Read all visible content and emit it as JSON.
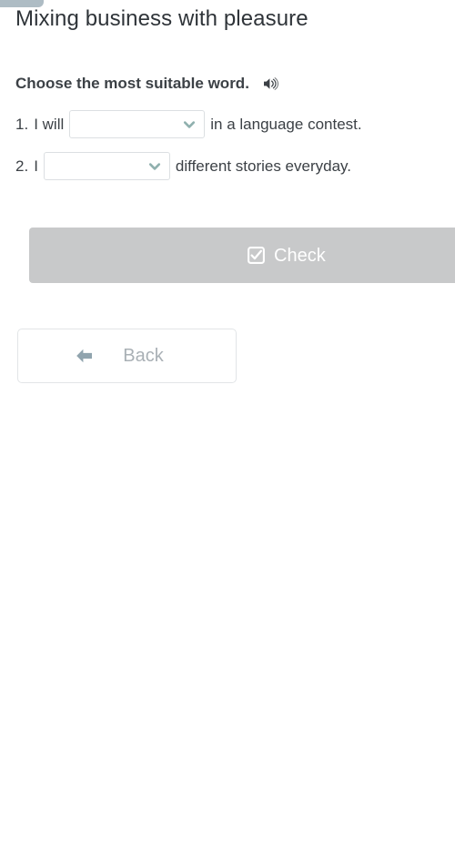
{
  "theme": {
    "page_background": "#ffffff",
    "text_color": "#3c4146",
    "title_color": "#2f3439",
    "accent_chevron": "#8fb0ae",
    "badge_color": "#aebcc4",
    "disabled_button_bg": "#c8c9ca",
    "back_arrow_color": "#90a4ae",
    "back_label_color": "#a9b0b5",
    "input_border": "#dcdfe2"
  },
  "header": {
    "badge_label": "",
    "title": "Mixing business with pleasure"
  },
  "instruction": {
    "text": "Choose the most suitable word.",
    "audio_icon": "speaker-icon"
  },
  "questions": [
    {
      "number": "1.",
      "prefix": "I will",
      "suffix": "in a language contest.",
      "select": {
        "value": "",
        "placeholder": "",
        "chevron_icon": "chevron-down-icon"
      }
    },
    {
      "number": "2.",
      "prefix": "I",
      "suffix": "different stories everyday.",
      "select": {
        "value": "",
        "placeholder": "",
        "chevron_icon": "chevron-down-icon"
      }
    }
  ],
  "actions": {
    "check": {
      "label": "Check",
      "icon": "checkbox-checked-icon",
      "state": "disabled"
    },
    "back": {
      "label": "Back",
      "icon": "arrow-left-icon"
    }
  }
}
